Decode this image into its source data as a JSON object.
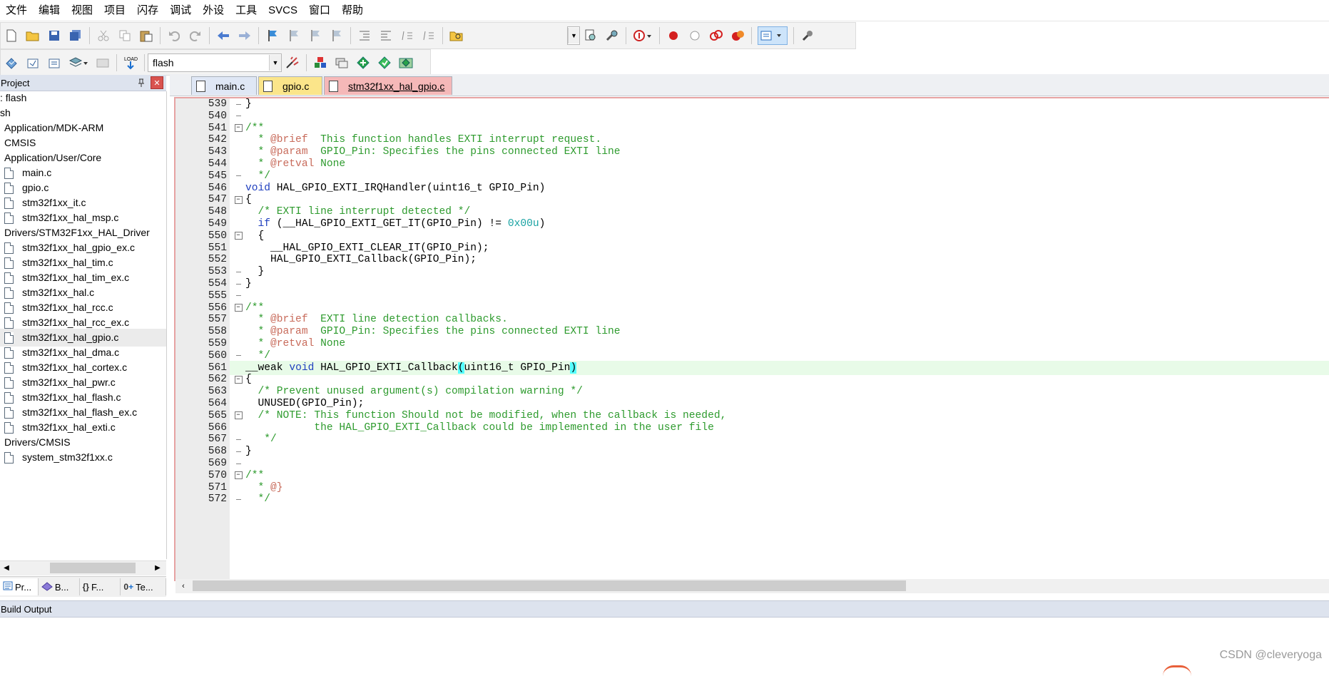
{
  "menu": [
    "文件",
    "编辑",
    "视图",
    "项目",
    "闪存",
    "调试",
    "外设",
    "工具",
    "SVCS",
    "窗口",
    "帮助"
  ],
  "toolbar2": {
    "target": "flash"
  },
  "project": {
    "title": "Project",
    "tree": [
      {
        "label": ": flash",
        "type": "root"
      },
      {
        "label": "sh",
        "type": "root"
      },
      {
        "label": "Application/MDK-ARM",
        "type": "group"
      },
      {
        "label": "CMSIS",
        "type": "group"
      },
      {
        "label": "Application/User/Core",
        "type": "group"
      },
      {
        "label": "main.c",
        "type": "file"
      },
      {
        "label": "gpio.c",
        "type": "file"
      },
      {
        "label": "stm32f1xx_it.c",
        "type": "file"
      },
      {
        "label": "stm32f1xx_hal_msp.c",
        "type": "file"
      },
      {
        "label": "Drivers/STM32F1xx_HAL_Driver",
        "type": "group"
      },
      {
        "label": "stm32f1xx_hal_gpio_ex.c",
        "type": "file"
      },
      {
        "label": "stm32f1xx_hal_tim.c",
        "type": "file"
      },
      {
        "label": "stm32f1xx_hal_tim_ex.c",
        "type": "file"
      },
      {
        "label": "stm32f1xx_hal.c",
        "type": "file"
      },
      {
        "label": "stm32f1xx_hal_rcc.c",
        "type": "file"
      },
      {
        "label": "stm32f1xx_hal_rcc_ex.c",
        "type": "file"
      },
      {
        "label": "stm32f1xx_hal_gpio.c",
        "type": "file",
        "selected": true
      },
      {
        "label": "stm32f1xx_hal_dma.c",
        "type": "file"
      },
      {
        "label": "stm32f1xx_hal_cortex.c",
        "type": "file"
      },
      {
        "label": "stm32f1xx_hal_pwr.c",
        "type": "file"
      },
      {
        "label": "stm32f1xx_hal_flash.c",
        "type": "file"
      },
      {
        "label": "stm32f1xx_hal_flash_ex.c",
        "type": "file"
      },
      {
        "label": "stm32f1xx_hal_exti.c",
        "type": "file"
      },
      {
        "label": "Drivers/CMSIS",
        "type": "group"
      },
      {
        "label": "system_stm32f1xx.c",
        "type": "file"
      }
    ],
    "bottom_tabs": [
      "Pr...",
      "B...",
      "F...",
      "Te..."
    ]
  },
  "editor_tabs": [
    {
      "label": "main.c",
      "active": false
    },
    {
      "label": "gpio.c",
      "active": false
    },
    {
      "label": "stm32f1xx_hal_gpio.c",
      "active": true
    }
  ],
  "code": [
    {
      "n": "539",
      "fold": "line",
      "text": "}"
    },
    {
      "n": "540",
      "fold": "line",
      "text": ""
    },
    {
      "n": "541",
      "fold": "box",
      "text": "/**"
    },
    {
      "n": "542",
      "fold": "",
      "text": "  * @brief  This function handles EXTI interrupt request."
    },
    {
      "n": "543",
      "fold": "",
      "text": "  * @param  GPIO_Pin: Specifies the pins connected EXTI line"
    },
    {
      "n": "544",
      "fold": "",
      "text": "  * @retval None"
    },
    {
      "n": "545",
      "fold": "line",
      "text": "  */"
    },
    {
      "n": "546",
      "fold": "",
      "text": "void HAL_GPIO_EXTI_IRQHandler(uint16_t GPIO_Pin)"
    },
    {
      "n": "547",
      "fold": "box",
      "text": "{"
    },
    {
      "n": "548",
      "fold": "",
      "text": "  /* EXTI line interrupt detected */"
    },
    {
      "n": "549",
      "fold": "",
      "text": "  if (__HAL_GPIO_EXTI_GET_IT(GPIO_Pin) != 0x00u)"
    },
    {
      "n": "550",
      "fold": "box",
      "text": "  {"
    },
    {
      "n": "551",
      "fold": "",
      "text": "    __HAL_GPIO_EXTI_CLEAR_IT(GPIO_Pin);"
    },
    {
      "n": "552",
      "fold": "",
      "text": "    HAL_GPIO_EXTI_Callback(GPIO_Pin);"
    },
    {
      "n": "553",
      "fold": "line",
      "text": "  }"
    },
    {
      "n": "554",
      "fold": "line",
      "text": "}"
    },
    {
      "n": "555",
      "fold": "line",
      "text": ""
    },
    {
      "n": "556",
      "fold": "box",
      "text": "/**"
    },
    {
      "n": "557",
      "fold": "",
      "text": "  * @brief  EXTI line detection callbacks."
    },
    {
      "n": "558",
      "fold": "",
      "text": "  * @param  GPIO_Pin: Specifies the pins connected EXTI line"
    },
    {
      "n": "559",
      "fold": "",
      "text": "  * @retval None"
    },
    {
      "n": "560",
      "fold": "line",
      "text": "  */"
    },
    {
      "n": "561",
      "fold": "",
      "text": "__weak void HAL_GPIO_EXTI_Callback(uint16_t GPIO_Pin)",
      "current": true
    },
    {
      "n": "562",
      "fold": "box",
      "text": "{"
    },
    {
      "n": "563",
      "fold": "",
      "text": "  /* Prevent unused argument(s) compilation warning */"
    },
    {
      "n": "564",
      "fold": "",
      "text": "  UNUSED(GPIO_Pin);"
    },
    {
      "n": "565",
      "fold": "box",
      "text": "  /* NOTE: This function Should not be modified, when the callback is needed,"
    },
    {
      "n": "566",
      "fold": "",
      "text": "           the HAL_GPIO_EXTI_Callback could be implemented in the user file"
    },
    {
      "n": "567",
      "fold": "line",
      "text": "   */"
    },
    {
      "n": "568",
      "fold": "line",
      "text": "}"
    },
    {
      "n": "569",
      "fold": "line",
      "text": ""
    },
    {
      "n": "570",
      "fold": "box",
      "text": "/**"
    },
    {
      "n": "571",
      "fold": "",
      "text": "  * @}"
    },
    {
      "n": "572",
      "fold": "line",
      "text": "  */"
    }
  ],
  "build_output": {
    "title": "Build Output"
  },
  "watermark": "CSDN @cleveryoga",
  "colors": {
    "comment": "#2e9b2e",
    "keyword": "#1f3fbf",
    "number": "#1aa3a3",
    "current_line": "#e8fbe8",
    "editor_border": "#e6a3a3",
    "tab_main": "#dfe7f5",
    "tab_gpio": "#fbe58a",
    "tab_active": "#f5b8b8"
  }
}
